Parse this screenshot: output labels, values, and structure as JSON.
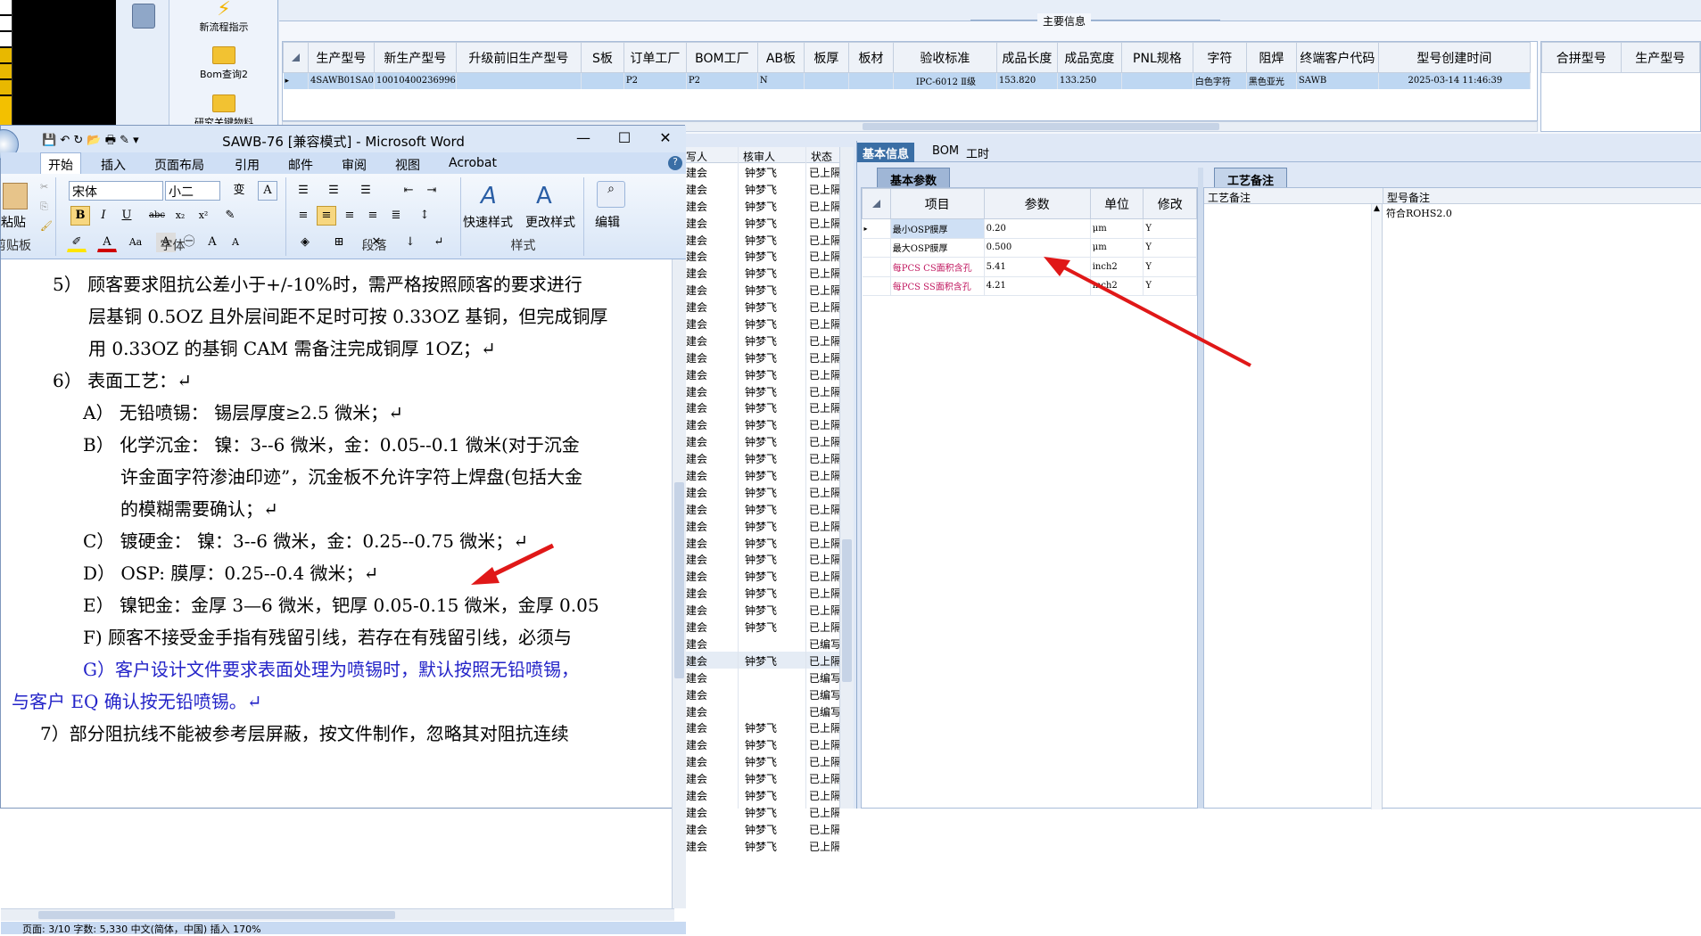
{
  "launcher": {
    "items": [
      {
        "label": "新流程指示"
      },
      {
        "label": "Bom查询2"
      },
      {
        "label": "研究关键物料"
      }
    ]
  },
  "top_grid": {
    "frame_title": "主要信息",
    "columns": [
      "生产型号",
      "新生产型号",
      "升级前旧生产型号",
      "S板",
      "订单工厂",
      "BOM工厂",
      "AB板",
      "板厚",
      "板材",
      "验收标准",
      "成品长度",
      "成品宽度",
      "PNL规格",
      "字符",
      "阻焊",
      "终端客户代码",
      "型号创建时间"
    ],
    "row": [
      "4SAWB01SA0",
      "10010400236996",
      "",
      "",
      "P2",
      "P2",
      "N",
      "",
      "",
      "IPC-6012 Ⅱ级",
      "153.820",
      "133.250",
      "",
      "白色字符",
      "黑色亚光",
      "SAWB",
      "2025-03-14 11:46:39"
    ],
    "extra_columns": [
      "合拼型号",
      "生产型号"
    ]
  },
  "mid_list": {
    "columns": [
      "写人",
      "核审人",
      "状态"
    ],
    "rows": [
      {
        "a": "建会",
        "b": "钟梦飞",
        "c": "已上隔"
      },
      {
        "a": "建会",
        "b": "钟梦飞",
        "c": "已上隔"
      },
      {
        "a": "建会",
        "b": "钟梦飞",
        "c": "已上隔"
      },
      {
        "a": "建会",
        "b": "钟梦飞",
        "c": "已上隔"
      },
      {
        "a": "建会",
        "b": "钟梦飞",
        "c": "已上隔"
      },
      {
        "a": "建会",
        "b": "钟梦飞",
        "c": "已上隔"
      },
      {
        "a": "建会",
        "b": "钟梦飞",
        "c": "已上隔"
      },
      {
        "a": "建会",
        "b": "钟梦飞",
        "c": "已上隔"
      },
      {
        "a": "建会",
        "b": "钟梦飞",
        "c": "已上隔"
      },
      {
        "a": "建会",
        "b": "钟梦飞",
        "c": "已上隔"
      },
      {
        "a": "建会",
        "b": "钟梦飞",
        "c": "已上隔"
      },
      {
        "a": "建会",
        "b": "钟梦飞",
        "c": "已上隔"
      },
      {
        "a": "建会",
        "b": "钟梦飞",
        "c": "已上隔"
      },
      {
        "a": "建会",
        "b": "钟梦飞",
        "c": "已上隔"
      },
      {
        "a": "建会",
        "b": "钟梦飞",
        "c": "已上隔"
      },
      {
        "a": "建会",
        "b": "钟梦飞",
        "c": "已上隔"
      },
      {
        "a": "建会",
        "b": "钟梦飞",
        "c": "已上隔"
      },
      {
        "a": "建会",
        "b": "钟梦飞",
        "c": "已上隔"
      },
      {
        "a": "建会",
        "b": "钟梦飞",
        "c": "已上隔"
      },
      {
        "a": "建会",
        "b": "钟梦飞",
        "c": "已上隔"
      },
      {
        "a": "建会",
        "b": "钟梦飞",
        "c": "已上隔"
      },
      {
        "a": "建会",
        "b": "钟梦飞",
        "c": "已上隔"
      },
      {
        "a": "建会",
        "b": "钟梦飞",
        "c": "已上隔"
      },
      {
        "a": "建会",
        "b": "钟梦飞",
        "c": "已上隔"
      },
      {
        "a": "建会",
        "b": "钟梦飞",
        "c": "已上隔"
      },
      {
        "a": "建会",
        "b": "钟梦飞",
        "c": "已上隔"
      },
      {
        "a": "建会",
        "b": "钟梦飞",
        "c": "已上隔"
      },
      {
        "a": "建会",
        "b": "钟梦飞",
        "c": "已上隔"
      },
      {
        "a": "建会",
        "b": "",
        "c": "已编写"
      },
      {
        "a": "建会",
        "b": "钟梦飞",
        "c": "已上隔"
      },
      {
        "a": "建会",
        "b": "",
        "c": "已编写"
      },
      {
        "a": "建会",
        "b": "",
        "c": "已编写"
      },
      {
        "a": "建会",
        "b": "",
        "c": "已编写"
      },
      {
        "a": "建会",
        "b": "钟梦飞",
        "c": "已上隔"
      },
      {
        "a": "建会",
        "b": "钟梦飞",
        "c": "已上隔"
      },
      {
        "a": "建会",
        "b": "钟梦飞",
        "c": "已上隔"
      },
      {
        "a": "建会",
        "b": "钟梦飞",
        "c": "已上隔"
      },
      {
        "a": "建会",
        "b": "钟梦飞",
        "c": "已上隔"
      },
      {
        "a": "建会",
        "b": "钟梦飞",
        "c": "已上隔"
      },
      {
        "a": "建会",
        "b": "钟梦飞",
        "c": "已上隔"
      },
      {
        "a": "建会",
        "b": "钟梦飞",
        "c": "已上隔"
      }
    ]
  },
  "right_panel": {
    "tabs": [
      "基本信息",
      "BOM",
      "工时"
    ],
    "subtab_basic": "基本参数",
    "subtab_notes": "工艺备注",
    "param_columns": [
      "项目",
      "参数",
      "单位",
      "修改"
    ],
    "params": [
      {
        "item": "最小OSP膜厚",
        "value": "0.20",
        "unit": "μm",
        "mod": "Y",
        "pink": false
      },
      {
        "item": "最大OSP膜厚",
        "value": "0.500",
        "unit": "μm",
        "mod": "Y",
        "pink": false
      },
      {
        "item": "每PCS CS面积含孔",
        "value": "5.41",
        "unit": "inch2",
        "mod": "Y",
        "pink": true
      },
      {
        "item": "每PCS SS面积含孔",
        "value": "4.21",
        "unit": "inch2",
        "mod": "Y",
        "pink": true
      }
    ],
    "notes_columns": [
      "工艺备注",
      "型号备注"
    ],
    "model_note": "符合ROHS2.0"
  },
  "word": {
    "title": "SAWB-76 [兼容模式] - Microsoft Word",
    "ribbon_tabs": [
      "开始",
      "插入",
      "页面布局",
      "引用",
      "邮件",
      "审阅",
      "视图",
      "Acrobat"
    ],
    "font_name": "宋体",
    "font_size": "小二",
    "group_labels": {
      "clipboard": "剪贴板",
      "font": "字体",
      "paragraph": "段落",
      "styles": "样式",
      "editing": "编辑"
    },
    "paste_label": "粘贴",
    "quick_style": "快速样式",
    "change_style": "更改样式",
    "edit_label": "编辑",
    "doc_lines": [
      "5） 顾客要求阻抗公差小于+/-10%时，需严格按照顾客的要求进行",
      "层基铜 0.5OZ 且外层间距不足时可按 0.33OZ 基铜，但完成铜厚",
      "用 0.33OZ 的基铜 CAM 需备注完成铜厚 1OZ；↵",
      "6） 表面工艺：↵",
      "A） 无铅喷锡：  锡层厚度≥2.5 微米；↵",
      "B） 化学沉金：  镍：3--6 微米，金：0.05--0.1 微米(对于沉金",
      "许金面字符渗油印迹”，沉金板不允许字符上焊盘(包括大金",
      "的模糊需要确认；↵",
      "C） 镀硬金：     镍：3--6 微米，金：0.25--0.75 微米；↵",
      "D） OSP:         膜厚：0.25--0.4 微米；↵",
      "E） 镍钯金：金厚 3—6 微米，钯厚 0.05-0.15 微米，金厚 0.05",
      "F) 顾客不接受金手指有残留引线，若存在有残留引线，必须与",
      "G）客户设计文件要求表面处理为喷锡时，默认按照无铅喷锡，",
      "与客户 EQ 确认按无铅喷锡。↵",
      "7）部分阻抗线不能被参考层屏蔽，按文件制作，忽略其对阻抗连续"
    ],
    "status_text": "页面: 3/10   字数: 5,330   中文(简体，中国)   插入   170%"
  }
}
